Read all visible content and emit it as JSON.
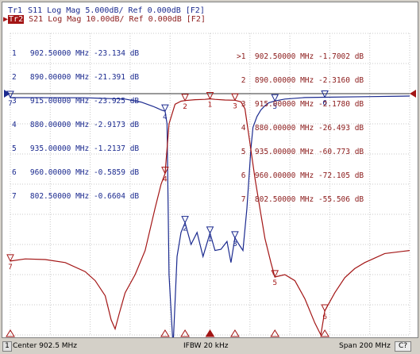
{
  "header": {
    "trace1": {
      "tag": "Tr1",
      "text": " S11 Log Mag 5.000dB/ Ref 0.000dB [F2]"
    },
    "trace2": {
      "tag": "Tr2",
      "text": " S21 Log Mag 10.00dB/ Ref 0.000dB [F2]"
    }
  },
  "marker_tables": {
    "s11": [
      "1   902.50000 MHz -23.134 dB",
      "2   890.00000 MHz -21.391 dB",
      "3   915.00000 MHz -23.925 dB",
      "4   880.00000 MHz -2.9173 dB",
      "5   935.00000 MHz -1.2137 dB",
      "6   960.00000 MHz -0.5859 dB",
      "7   802.50000 MHz -0.6604 dB"
    ],
    "s21": [
      ">1  902.50000 MHz -1.7002 dB",
      " 2  890.00000 MHz -2.3160 dB",
      " 3  915.00000 MHz -2.1780 dB",
      " 4  880.00000 MHz -26.493 dB",
      " 5  935.00000 MHz -60.773 dB",
      " 6  960.00000 MHz -72.105 dB",
      " 7  802.50000 MHz -55.506 dB"
    ]
  },
  "marker_labels": [
    "1",
    "2",
    "3",
    "4",
    "5",
    "6",
    "7"
  ],
  "status": {
    "channel": "1",
    "center": "Center 902.5 MHz",
    "ifbw": "IFBW 20 kHz",
    "span": "Span 200 MHz",
    "cal": "C?"
  },
  "colors": {
    "s11": "#1b2a8f",
    "s21": "#a31515",
    "grid": "#c8c8c8"
  },
  "chart_data": {
    "type": "line",
    "x_unit": "MHz",
    "x_range": [
      802.5,
      1002.5
    ],
    "grid": true,
    "series": [
      {
        "name": "S11",
        "unit": "dB",
        "scale_per_div": 5,
        "ref": 0,
        "x": [
          802.5,
          840,
          860,
          868,
          874,
          876,
          878,
          879,
          880,
          881,
          882,
          884,
          886,
          888,
          890,
          893,
          896,
          899,
          902.5,
          905,
          908,
          911,
          913,
          915,
          917,
          919,
          921,
          923,
          924,
          926,
          928,
          930,
          932,
          935,
          940,
          950,
          960,
          980,
          1002.5
        ],
        "y": [
          -0.66,
          -0.68,
          -0.9,
          -1.4,
          -2.1,
          -2.4,
          -2.7,
          -2.8,
          -2.9,
          -5,
          -30,
          -42,
          -27,
          -23,
          -21.4,
          -25,
          -23,
          -27,
          -23.1,
          -26,
          -25.8,
          -24.5,
          -28,
          -23.9,
          -25,
          -26,
          -19,
          -9,
          -5.6,
          -3.8,
          -2.7,
          -2,
          -1.5,
          -1.21,
          -0.9,
          -0.65,
          -0.59,
          -0.5,
          -0.4
        ]
      },
      {
        "name": "S21",
        "unit": "dB",
        "scale_per_div": 10,
        "ref": 0,
        "x": [
          802.5,
          810,
          820,
          830,
          840,
          845,
          850,
          853,
          855,
          857,
          860,
          865,
          870,
          875,
          878,
          880,
          882,
          885,
          888,
          890,
          895,
          900,
          902.5,
          905,
          910,
          915,
          918,
          920,
          922,
          925,
          928,
          930,
          933,
          935,
          940,
          945,
          950,
          955,
          958,
          960,
          965,
          970,
          975,
          980,
          990,
          1002.5
        ],
        "y": [
          -55.5,
          -54.8,
          -55,
          -56,
          -59,
          -62,
          -67,
          -75,
          -78,
          -73,
          -66,
          -60,
          -52,
          -38,
          -30,
          -26.5,
          -10,
          -3.5,
          -2.5,
          -2.3,
          -2,
          -1.9,
          -1.7,
          -1.9,
          -2.1,
          -2.18,
          -2.7,
          -5,
          -14,
          -28,
          -40,
          -48,
          -56,
          -60.8,
          -60,
          -62,
          -68,
          -76,
          -80,
          -72,
          -66,
          -61,
          -58,
          -56,
          -53,
          -52
        ]
      }
    ],
    "markers": {
      "s11": [
        {
          "id": "1",
          "x": 902.5,
          "y": -23.134
        },
        {
          "id": "2",
          "x": 890,
          "y": -21.391
        },
        {
          "id": "3",
          "x": 915,
          "y": -23.925
        },
        {
          "id": "4",
          "x": 880,
          "y": -2.9173
        },
        {
          "id": "5",
          "x": 935,
          "y": -1.2137
        },
        {
          "id": "6",
          "x": 960,
          "y": -0.5859
        },
        {
          "id": "7",
          "x": 802.5,
          "y": -0.6604
        }
      ],
      "s21": [
        {
          "id": "1",
          "x": 902.5,
          "y": -1.7002
        },
        {
          "id": "2",
          "x": 890,
          "y": -2.316
        },
        {
          "id": "3",
          "x": 915,
          "y": -2.178
        },
        {
          "id": "4",
          "x": 880,
          "y": -26.493
        },
        {
          "id": "5",
          "x": 935,
          "y": -60.773
        },
        {
          "id": "6",
          "x": 960,
          "y": -72.105
        },
        {
          "id": "7",
          "x": 802.5,
          "y": -55.506
        }
      ]
    }
  }
}
